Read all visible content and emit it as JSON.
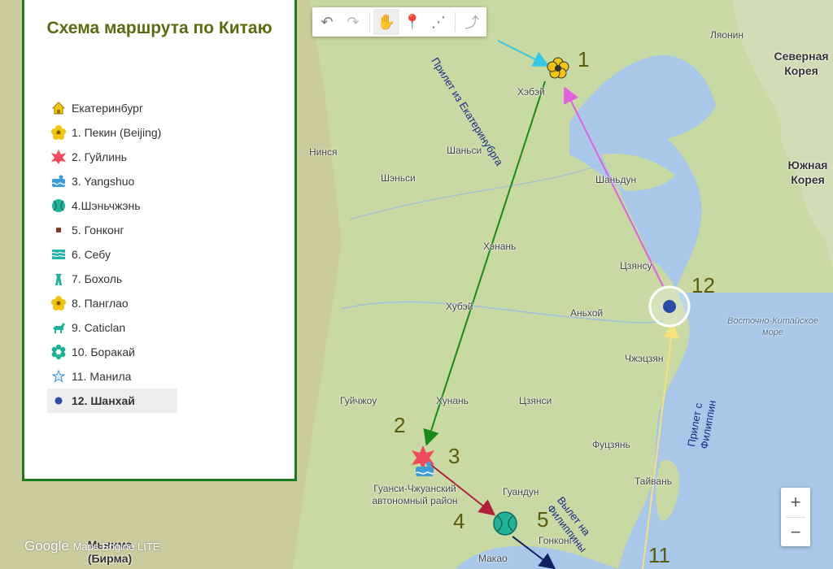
{
  "legend": {
    "title": "Схема маршрута по Китаю",
    "items": [
      {
        "label": "Екатеринбург",
        "icon": "house-icon"
      },
      {
        "label": "1. Пекин (Beijing)",
        "icon": "flower-icon"
      },
      {
        "label": "2. Гуйлинь",
        "icon": "star-burst-icon"
      },
      {
        "label": "3. Yangshuo",
        "icon": "swim-icon"
      },
      {
        "label": "4.Шэньчжэнь",
        "icon": "tennis-ball-icon"
      },
      {
        "label": "5. Гонконг",
        "icon": "square-icon"
      },
      {
        "label": "6. Себу",
        "icon": "waves-icon"
      },
      {
        "label": "7. Бохоль",
        "icon": "tower-icon"
      },
      {
        "label": "8. Панглао",
        "icon": "flower-icon"
      },
      {
        "label": "9. Caticlan",
        "icon": "horse-icon"
      },
      {
        "label": "10. Боракай",
        "icon": "flower-ring-icon"
      },
      {
        "label": "11. Манила",
        "icon": "star-icon"
      },
      {
        "label": "12. Шанхай",
        "icon": "dot-icon"
      }
    ]
  },
  "toolbar": {
    "buttons": [
      "undo-icon",
      "redo-icon",
      "hand-icon",
      "marker-icon",
      "line-icon",
      "directions-icon"
    ]
  },
  "map": {
    "labels": {
      "liaoning": "Ляонин",
      "north_korea": "Северная Корея",
      "hebei": "Хэбэй",
      "ningxia": "Нинся",
      "shanxi": "Шаньси",
      "shaanxi": "Шэньси",
      "shandong": "Шаньдун",
      "south_korea": "Южная Корея",
      "henan": "Хэнань",
      "jiangsu": "Цзянсу",
      "hubei": "Хубэй",
      "anhui": "Аньхой",
      "east_china_sea": "Восточно-Китайское море",
      "zhejiang": "Чжэцзян",
      "guizhou": "Гуйчжоу",
      "hunan": "Хунань",
      "jiangxi": "Цзянси",
      "fujian": "Фуцзянь",
      "taiwan": "Тайвань",
      "guangxi": "Гуанси-Чжуанский автономный район",
      "guangdong": "Гуандун",
      "hongkong": "Гонконг",
      "macao": "Макао",
      "myanmar": "Мьянма (Бирма)"
    },
    "route_numbers": {
      "n1": "1",
      "n2": "2",
      "n3": "3",
      "n4": "4",
      "n5": "5",
      "n11": "11",
      "n12": "12"
    },
    "notes": {
      "arrival_ekb": "Прилет из Екатеринубрга",
      "arrival_ph": "Прилет с Филиппин",
      "departure_ph": "Вылет на Филиппины"
    }
  },
  "zoom": {
    "in": "+",
    "out": "−"
  },
  "branding": {
    "google": "Google",
    "engine": "Maps Engine LITE"
  },
  "colors": {
    "legend_border": "#1e7a1e",
    "title": "#5b6b10",
    "route_green": "#1a8a1a",
    "route_magenta": "#e060e0",
    "route_yellow": "#f5e27a",
    "route_crimson": "#b0203a",
    "route_navy": "#102060",
    "arrow_cyan": "#35c8e8"
  }
}
